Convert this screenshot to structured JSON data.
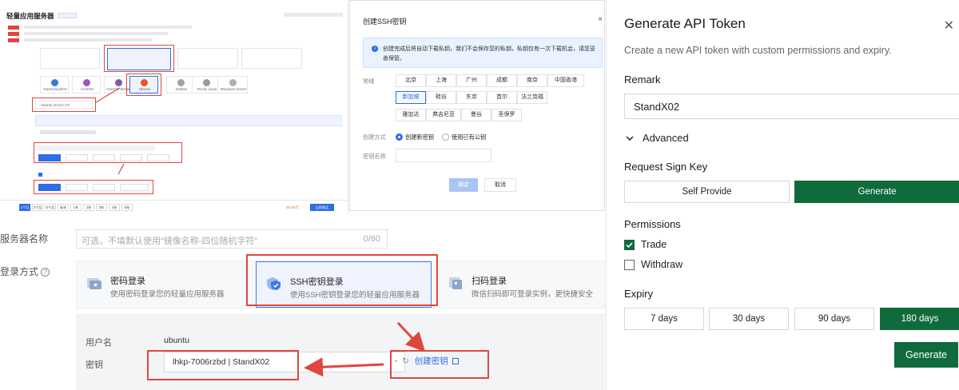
{
  "panel_a": {
    "title": "轻量应用服务器",
    "instance_images": [
      "OpenCloudOS",
      "CentOS",
      "CentOS Stream",
      "Ubuntu",
      "Debian",
      "Rocky Linux",
      "Windows Server"
    ],
    "selected_version": "Ubuntu 20.04 LTS",
    "duration_tabs": [
      "1个月",
      "2个月",
      "3个月",
      "半年",
      "1年",
      "2年",
      "3年",
      "4年",
      "5年"
    ],
    "price_value": "39.00元",
    "buy_button": "立即购买"
  },
  "ssh_dialog": {
    "title": "创建SSH密钥",
    "close": "×",
    "info_text": "创建完成后将自动下载私钥，我们不会保存您的私钥，私钥仅有一次下载机会，请您妥善保管。",
    "region_label": "地域",
    "regions": [
      "北京",
      "上海",
      "广州",
      "成都",
      "南京",
      "中国香港",
      "新加坡",
      "硅谷",
      "东京",
      "首尔",
      "法兰克福",
      "雅加达",
      "弗吉尼亚",
      "曼谷",
      "圣保罗"
    ],
    "selected_region": "新加坡",
    "method_label": "创建方式",
    "method_new": "创建新密钥",
    "method_existing": "使用已有公钥",
    "keyname_label": "密钥名称",
    "ok_label": "确定",
    "cancel_label": "取消"
  },
  "server_form": {
    "name_label": "服务器名称",
    "name_placeholder": "可选，不填默认使用“镜像名称-四位随机字符”",
    "name_counter": "0/60",
    "login_label": "登录方式",
    "login_help": "?",
    "options": [
      {
        "title": "密码登录",
        "desc": "使用密码登录您的轻量应用服务器",
        "selected": false,
        "icon": "password-icon"
      },
      {
        "title": "SSH密钥登录",
        "desc": "使用SSH密钥登录您的轻量应用服务器",
        "selected": true,
        "icon": "shield-key-icon"
      },
      {
        "title": "扫码登录",
        "desc": "微信扫码即可登录实例，更快捷安全",
        "selected": false,
        "icon": "qr-scan-icon"
      }
    ],
    "user_label": "用户名",
    "user_value": "ubuntu",
    "key_label": "密钥",
    "key_value": "lhkp-7006rzbd | StandX02",
    "create_key_label": "创建密钥"
  },
  "api_token": {
    "title": "Generate API Token",
    "subtitle": "Create a new API token with custom permissions and expiry.",
    "remark_label": "Remark",
    "remark_value": "StandX02",
    "advanced_label": "Advanced",
    "sign_key_label": "Request Sign Key",
    "sign_key_options": [
      "Self Provide",
      "Generate"
    ],
    "sign_key_selected": "Generate",
    "permissions_label": "Permissions",
    "permissions": [
      {
        "label": "Trade",
        "checked": true
      },
      {
        "label": "Withdraw",
        "checked": false
      }
    ],
    "expiry_label": "Expiry",
    "expiry_options": [
      "7 days",
      "30 days",
      "90 days",
      "180 days"
    ],
    "expiry_selected": "180 days",
    "generate_button": "Generate",
    "accent": "#0f6b3b"
  },
  "colors": {
    "annotation_red": "#e0463f",
    "primary_blue": "#2f6ce5"
  }
}
